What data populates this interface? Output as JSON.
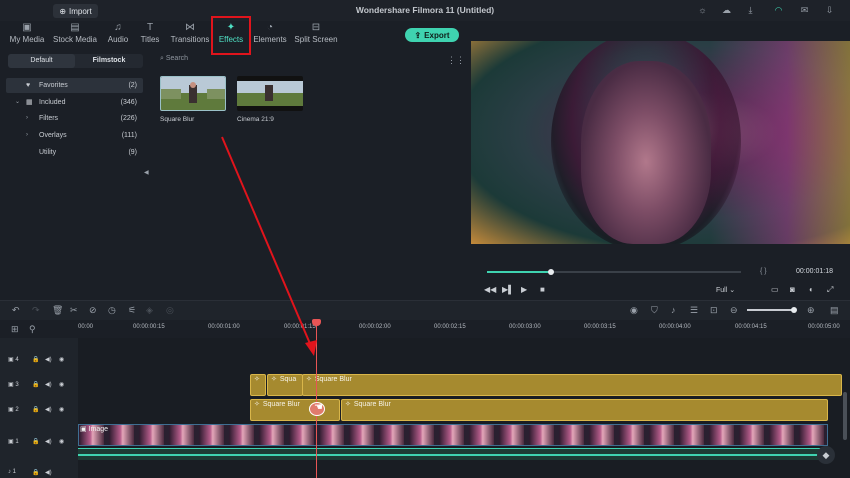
{
  "header": {
    "import_label": "Import",
    "title": "Wondershare Filmora 11 (Untitled)"
  },
  "tabs": [
    {
      "label": "My Media",
      "icon": "media-icon"
    },
    {
      "label": "Stock Media",
      "icon": "stock-media-icon"
    },
    {
      "label": "Audio",
      "icon": "music-note-icon"
    },
    {
      "label": "Titles",
      "icon": "title-icon"
    },
    {
      "label": "Transitions",
      "icon": "transitions-icon"
    },
    {
      "label": "Effects",
      "icon": "sparkle-icon",
      "active": true
    },
    {
      "label": "Elements",
      "icon": "elements-icon"
    },
    {
      "label": "Split Screen",
      "icon": "split-screen-icon"
    }
  ],
  "export_label": "Export",
  "sidebar": {
    "segments": [
      "Default",
      "Filmstock"
    ],
    "items": [
      {
        "label": "Favorites",
        "count": "(2)"
      },
      {
        "label": "Included",
        "count": "(346)"
      },
      {
        "label": "Filters",
        "count": "(226)"
      },
      {
        "label": "Overlays",
        "count": "(111)"
      },
      {
        "label": "Utility",
        "count": "(9)"
      }
    ]
  },
  "search": {
    "placeholder": "Search"
  },
  "effects": [
    {
      "name": "Square Blur"
    },
    {
      "name": "Cinema 21:9"
    }
  ],
  "player": {
    "progress": 0.25,
    "timecode": "00:00:01:18",
    "brackets": "{  }",
    "quality": "Full"
  },
  "ruler": {
    "labels": [
      "00:00",
      "00:00:00:15",
      "00:00:01:00",
      "00:00:01:15",
      "00:00:02:00",
      "00:00:02:15",
      "00:00:03:00",
      "00:00:03:15",
      "00:00:04:00",
      "00:00:04:15",
      "00:00:05:00"
    ]
  },
  "tracks": {
    "headers": [
      "4",
      "3",
      "2",
      "1",
      "1"
    ],
    "clips_track3": [
      "Squa",
      "Square Blur"
    ],
    "clips_track2": [
      "Square Blur",
      "Square Blur"
    ],
    "video_label": "Image"
  },
  "colors": {
    "accent": "#3fd3b0",
    "clip": "#a68a2f",
    "playhead": "#e85555",
    "highlight": "#e0141c"
  }
}
